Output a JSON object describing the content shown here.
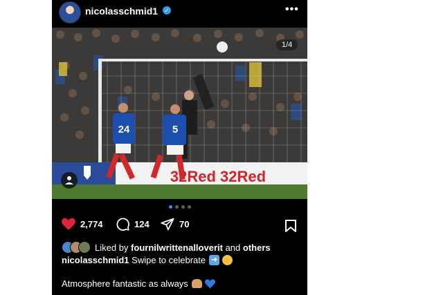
{
  "post": {
    "username": "nicolasschmid1",
    "verified": true,
    "more_icon": "more-horizontal-icon",
    "photo_counter": "1/4",
    "photo_board_text": "32Red 32Red",
    "player_numbers": [
      "24",
      "5"
    ],
    "carousel": {
      "total": 4,
      "active_index": 0
    },
    "likes_count": "2,774",
    "comments_count": "124",
    "shares_count": "70",
    "liked_by": {
      "prefix": "Liked by",
      "user": "fournilwrittenalloverit",
      "middle": "and",
      "suffix": "others"
    },
    "caption": {
      "username": "nicolasschmid1",
      "text": "Swipe to celebrate"
    },
    "comment_text": "Atmosphere fantastic as always",
    "colors": {
      "like_heart": "#e0243d",
      "accent_dot": "#3a8cf0",
      "verified": "#3897f0",
      "background": "#000000"
    }
  }
}
